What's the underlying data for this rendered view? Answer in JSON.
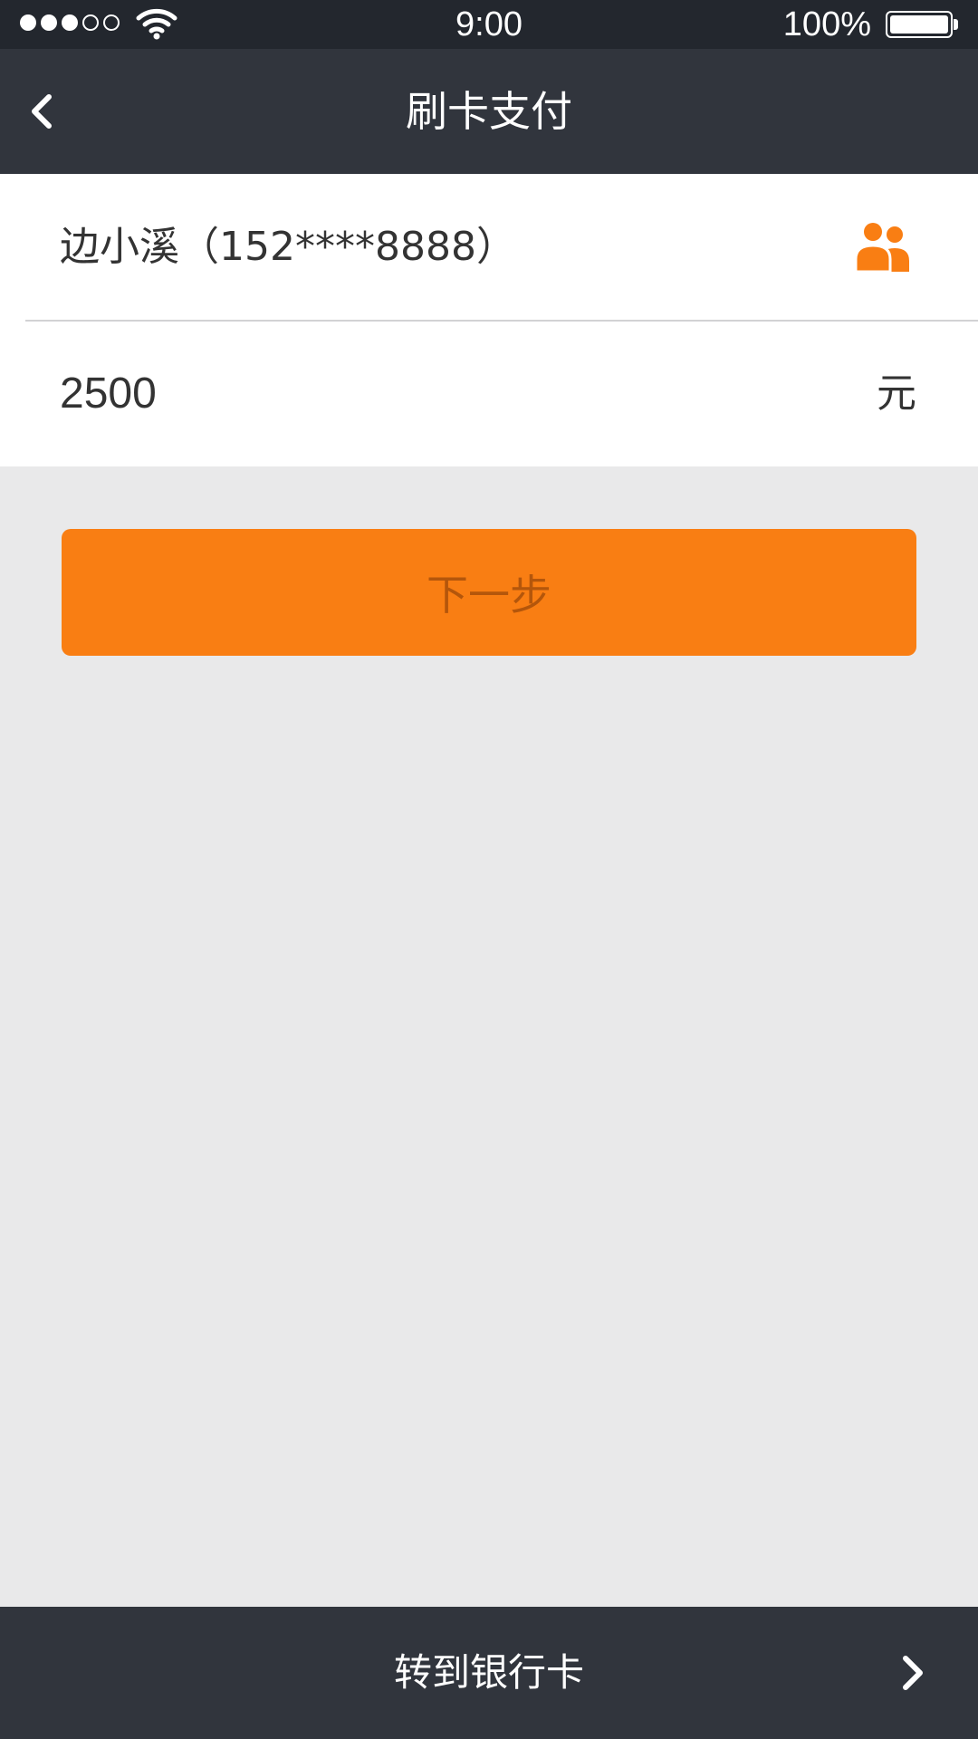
{
  "status_bar": {
    "time": "9:00",
    "battery_percent": "100%",
    "signal_bars_filled": 3,
    "signal_bars_total": 5,
    "battery_level": 1.0
  },
  "nav": {
    "title": "刷卡支付",
    "back_icon": "chevron-left-icon"
  },
  "form": {
    "payee": "边小溪（152****8888）",
    "contacts_icon": "contacts-icon",
    "amount_value": "2500",
    "amount_unit": "元"
  },
  "actions": {
    "next_label": "下一步"
  },
  "bottom_bar": {
    "label": "转到银行卡",
    "icon": "chevron-right-icon"
  },
  "colors": {
    "accent": "#f97e13",
    "nav_background": "#31353d",
    "status_background": "#23272e",
    "page_background": "#e9e9ea"
  }
}
